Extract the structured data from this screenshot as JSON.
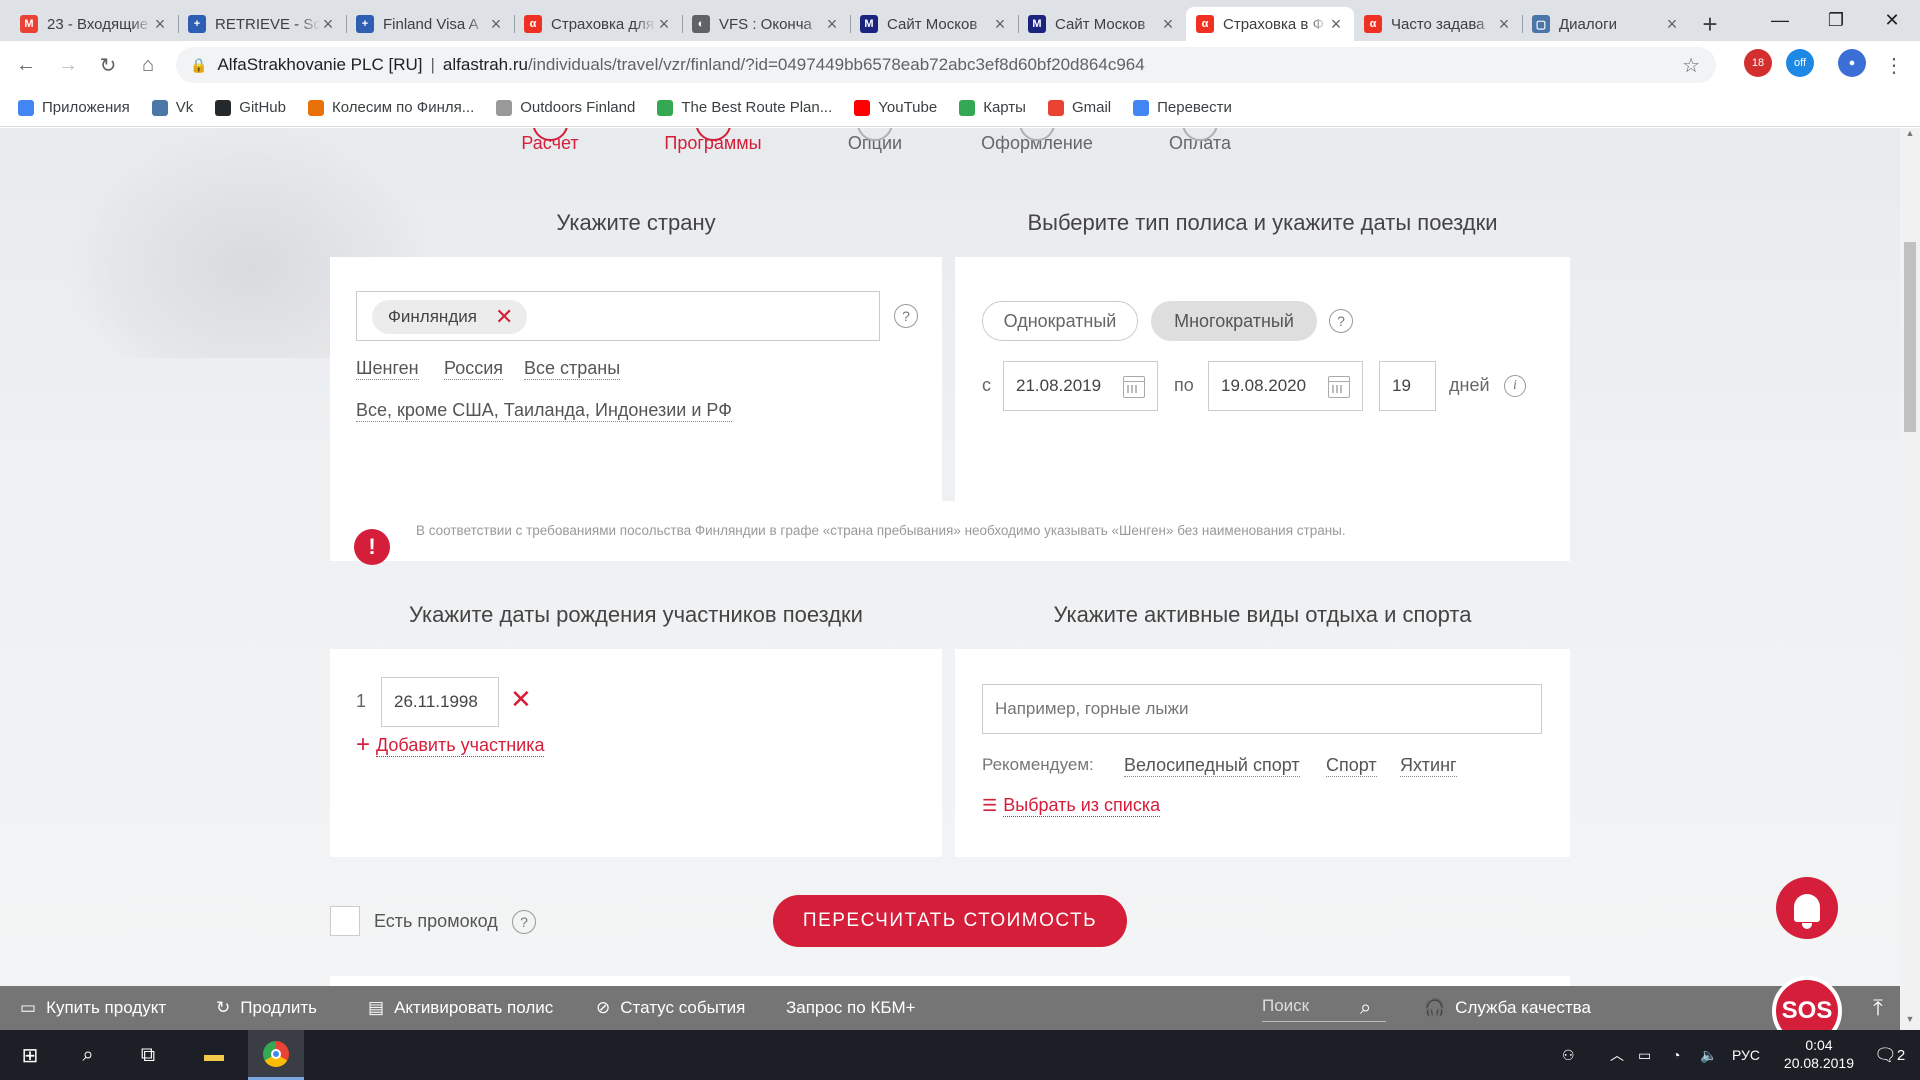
{
  "browser": {
    "tabs": [
      {
        "title": "23 - Входящие",
        "fav_color": "#ea4335",
        "fav_char": "M",
        "active": false
      },
      {
        "title": "RETRIEVE - Sc",
        "fav_color": "#2f5fb3",
        "fav_char": "+",
        "active": false
      },
      {
        "title": "Finland Visa A",
        "fav_color": "#2f5fb3",
        "fav_char": "+",
        "active": false
      },
      {
        "title": "Страховка для",
        "fav_color": "#ef3124",
        "fav_char": "α",
        "active": false
      },
      {
        "title": "VFS : Оконча",
        "fav_color": "#5f6368",
        "fav_char": "◐",
        "active": false
      },
      {
        "title": "Сайт Москов",
        "fav_color": "#1a237e",
        "fav_char": "M",
        "active": false
      },
      {
        "title": "Сайт Москов",
        "fav_color": "#1a237e",
        "fav_char": "M",
        "active": false
      },
      {
        "title": "Страховка в Ф",
        "fav_color": "#ef3124",
        "fav_char": "α",
        "active": true
      },
      {
        "title": "Часто задава",
        "fav_color": "#ef3124",
        "fav_char": "α",
        "active": false
      },
      {
        "title": "Диалоги",
        "fav_color": "#4a76a8",
        "fav_char": "▢",
        "active": false
      }
    ],
    "tab_close": "×",
    "new_tab": "+",
    "url_org": "AlfaStrakhovanie PLC [RU]",
    "url_separator": "|",
    "url_host": "alfastrah.ru",
    "url_path": "/individuals/travel/vzr/finland/?id=0497449bb6578eab72abc3ef8d60bf20d864c964",
    "ext_badge_1": "18",
    "ext_badge_2": "off",
    "bookmarks": [
      {
        "label": "Приложения",
        "color": "#4285f4"
      },
      {
        "label": "Vk",
        "color": "#4a76a8"
      },
      {
        "label": "GitHub",
        "color": "#24292e"
      },
      {
        "label": "Колесим по Финля...",
        "color": "#e8710a"
      },
      {
        "label": "Outdoors Finland",
        "color": "#999999"
      },
      {
        "label": "The Best Route Plan...",
        "color": "#34a853"
      },
      {
        "label": "YouTube",
        "color": "#ff0000"
      },
      {
        "label": "Карты",
        "color": "#34a853"
      },
      {
        "label": "Gmail",
        "color": "#ea4335"
      },
      {
        "label": "Перевести",
        "color": "#4285f4"
      }
    ]
  },
  "steps": [
    {
      "label": "Расчет",
      "state": "red"
    },
    {
      "label": "Программы",
      "state": "red"
    },
    {
      "label": "Опции",
      "state": "grey"
    },
    {
      "label": "Оформление",
      "state": "grey"
    },
    {
      "label": "Оплата",
      "state": "grey"
    }
  ],
  "country": {
    "title": "Укажите страну",
    "chip": "Финляндия",
    "help": "?",
    "quick_links": [
      "Шенген",
      "Россия",
      "Все страны"
    ],
    "all_except": "Все, кроме США, Таиланда, Индонезии и РФ"
  },
  "policy": {
    "title": "Выберите тип полиса и укажите даты поездки",
    "single": "Однократный",
    "multi": "Многократный",
    "help": "?",
    "from_label": "с",
    "from_date": "21.08.2019",
    "to_label": "по",
    "to_date": "19.08.2020",
    "days_value": "19",
    "days_label": "дней",
    "info": "i"
  },
  "alert": {
    "icon": "!",
    "text": "В соответствии с требованиями посольства Финляндии в графе «страна пребывания» необходимо указывать «Шенген» без наименования страны."
  },
  "participants": {
    "title": "Укажите даты рождения участников поездки",
    "items": [
      {
        "num": "1",
        "birthdate": "26.11.1998"
      }
    ],
    "add_label": "Добавить участника",
    "add_icon": "+"
  },
  "activities": {
    "title": "Укажите активные виды отдыха и спорта",
    "placeholder": "Например, горные лыжи",
    "recommend_label": "Рекомендуем:",
    "recommend": [
      "Велосипедный спорт",
      "Спорт",
      "Яхтинг"
    ],
    "choose_list": "Выбрать из списка"
  },
  "promo": {
    "label": "Есть промокод",
    "help": "?"
  },
  "recalc_button": "ПЕРЕСЧИТАТЬ СТОИМОСТЬ",
  "footer": {
    "items": [
      {
        "icon": "▭",
        "label": "Купить продукт"
      },
      {
        "icon": "↻",
        "label": "Продлить"
      },
      {
        "icon": "▤",
        "label": "Активировать полис"
      },
      {
        "icon": "⊘",
        "label": "Статус события"
      },
      {
        "icon": "",
        "label": "Запрос по КБМ+"
      }
    ],
    "search_placeholder": "Поиск",
    "quality": "Служба качества",
    "sos": "SOS"
  },
  "taskbar": {
    "lang": "РУС",
    "time": "0:04",
    "date": "20.08.2019",
    "notif_count": "2"
  }
}
